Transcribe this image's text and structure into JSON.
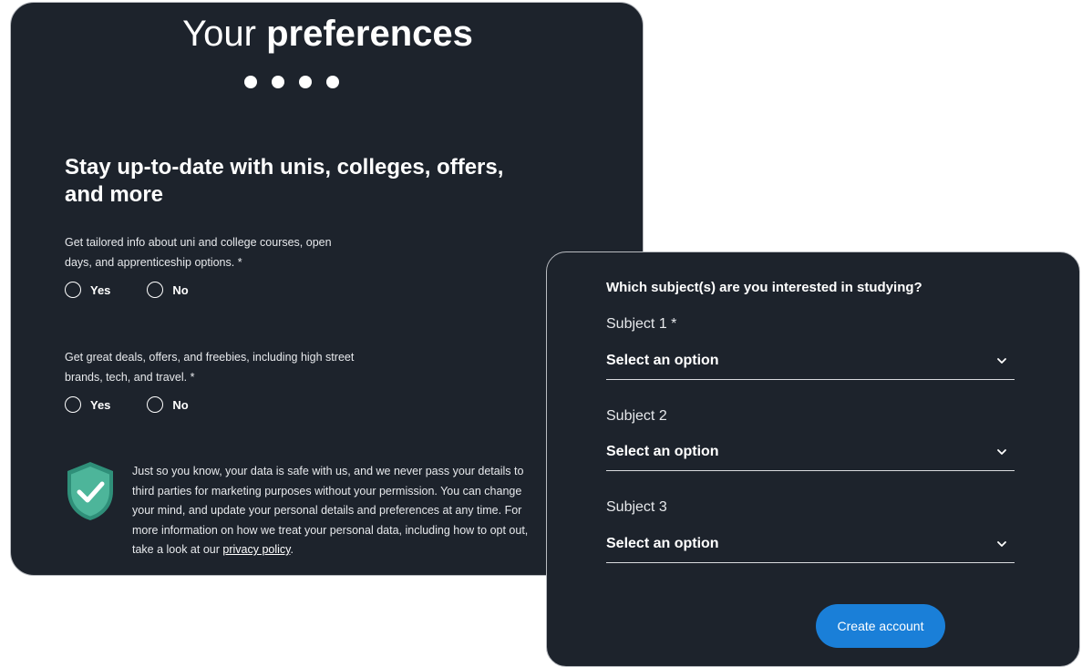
{
  "left_panel": {
    "title_light": "Your",
    "title_bold": "preferences",
    "step_dots": 4,
    "headline": "Stay up-to-date with unis, colleges, offers, and more",
    "question1": "Get tailored info about uni and college courses, open days, and apprenticeship options. *",
    "question2": "Get great deals, offers, and freebies, including high street brands, tech, and travel. *",
    "yes_label": "Yes",
    "no_label": "No",
    "privacy_text": "Just so you know, your data is safe with us, and we never pass your details to third parties for marketing purposes without your permission. You can change your mind, and update your personal details and preferences at any time. For more information on how we treat your personal data, including how to opt out, take a look at our",
    "privacy_link": "privacy policy",
    "privacy_end": ".",
    "shield_color": "#4db59a"
  },
  "right_panel": {
    "question": "Which subject(s) are you interested in studying?",
    "subjects": [
      {
        "label": "Subject 1 *",
        "value": "Select an option"
      },
      {
        "label": "Subject 2",
        "value": "Select an option"
      },
      {
        "label": "Subject 3",
        "value": "Select an option"
      }
    ],
    "create_button": "Create account",
    "button_color": "#1a7fd8"
  },
  "colors": {
    "panel_bg": "#1d232c",
    "page_bg": "#ffffff"
  }
}
